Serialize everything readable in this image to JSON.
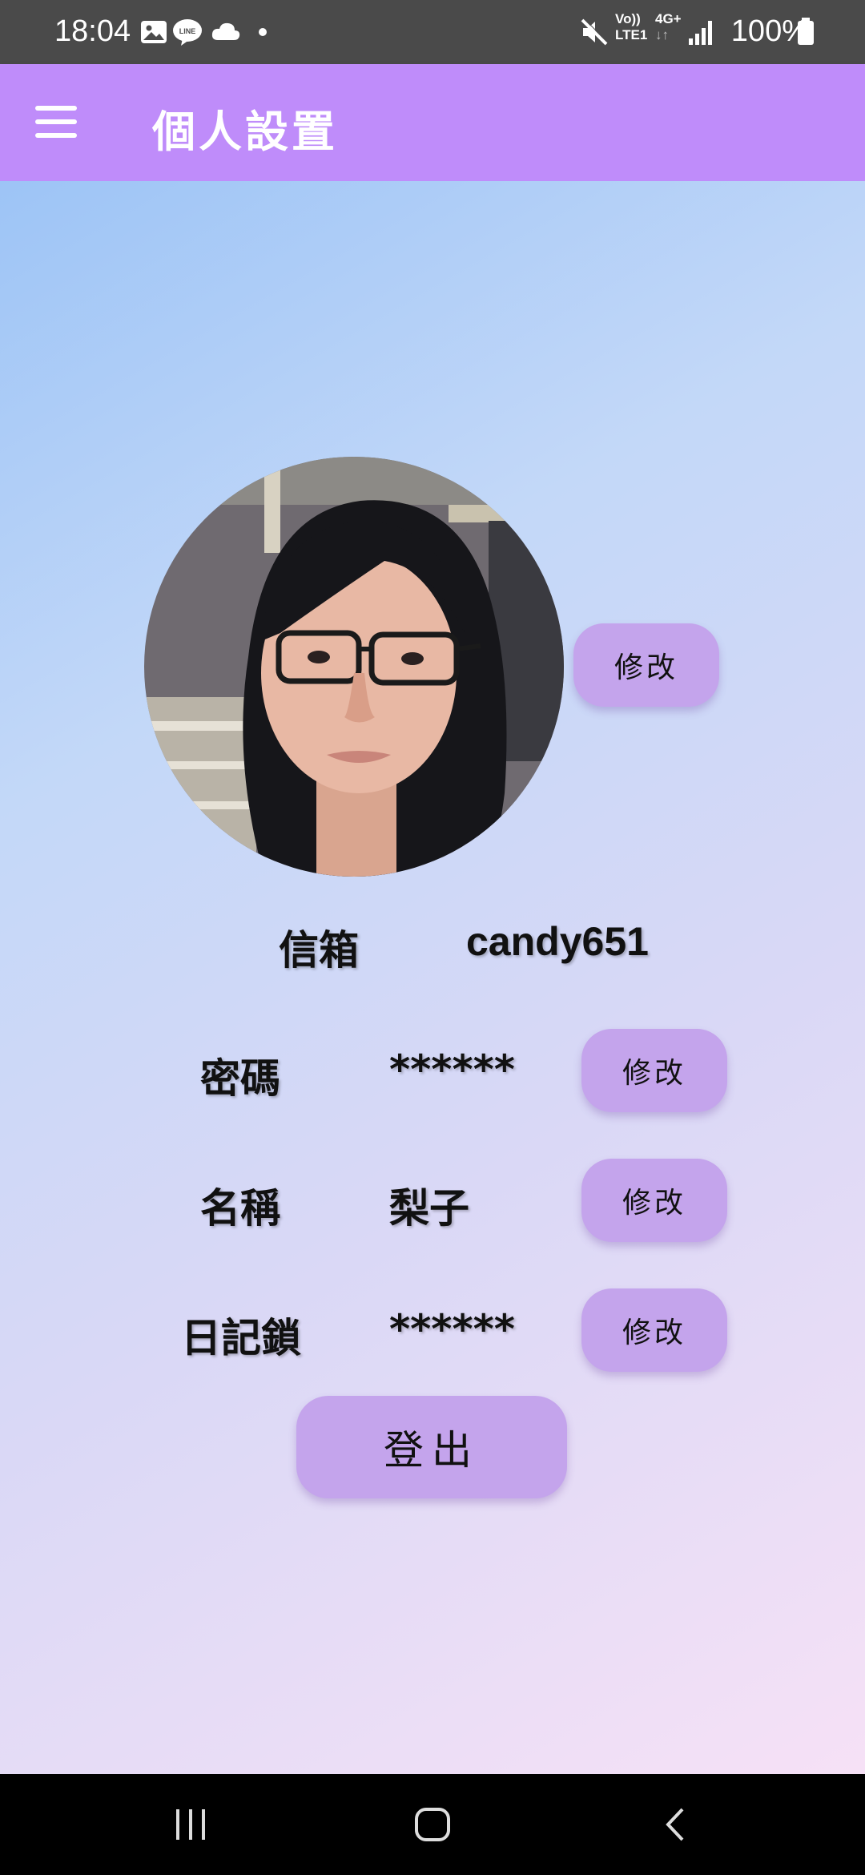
{
  "status_bar": {
    "time": "18:04",
    "network_line1": "Vo))",
    "network_line2": "LTE1",
    "network_type": "4G+",
    "network_arrows": "↓↑",
    "battery": "100%",
    "icons": [
      "gallery-icon",
      "line-app-icon",
      "cloud-icon",
      "dot-icon",
      "mute-icon",
      "signal-icon",
      "battery-icon"
    ]
  },
  "app_bar": {
    "title": "個人設置",
    "menu_icon": "hamburger-menu-icon"
  },
  "profile": {
    "avatar_edit_label": "修改",
    "email_label": "信箱",
    "email_value": "candy651",
    "password_label": "密碼",
    "password_value": "******",
    "password_edit_label": "修改",
    "name_label": "名稱",
    "name_value": "梨子",
    "name_edit_label": "修改",
    "diary_lock_label": "日記鎖",
    "diary_lock_value": "******",
    "diary_lock_edit_label": "修改",
    "logout_label": "登出"
  },
  "colors": {
    "app_bar": "#bf8cfa",
    "button": "#c4a4ec",
    "status_bar": "#4a4a4a",
    "nav_bar": "#000000"
  },
  "nav_bar": {
    "icons": [
      "recent-apps-icon",
      "home-icon",
      "back-icon"
    ]
  }
}
